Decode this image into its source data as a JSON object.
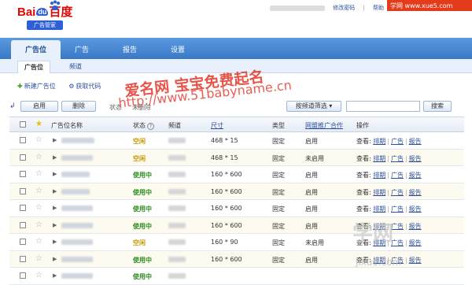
{
  "header": {
    "logo_bai": "Bai",
    "logo_du": "du",
    "logo_cn": "百度",
    "logo_sub": "广告管家",
    "links": [
      "修改密码",
      "帮助"
    ],
    "badge": "学网 www.xue5.com"
  },
  "nav": {
    "tabs": [
      "广告位",
      "广告",
      "报告",
      "设置"
    ],
    "active": "广告位"
  },
  "subnav": {
    "items": [
      "广告位",
      "频道"
    ]
  },
  "actions": {
    "new_label": "新建广告位",
    "code_label": "获取代码"
  },
  "watermark": {
    "line1": "爱名网 宝宝免费起名",
    "line2": "http://www.51babyname.cn",
    "line3": "学网",
    "line4": "jixue.com"
  },
  "toolbar": {
    "enable": "启用",
    "delete": "删除",
    "status_prefix": "状态",
    "status_value": "未删除",
    "filter": "按频道筛选",
    "search": "搜索"
  },
  "table": {
    "headers": {
      "name": "广告位名称",
      "status": "状态",
      "channel": "频道",
      "size": "尺寸",
      "type": "类型",
      "union": "网盟推广合作",
      "ops": "操作"
    },
    "rows": [
      {
        "status": "空闲",
        "size": "468 * 15",
        "type": "固定",
        "union": "启用",
        "view": "查看:"
      },
      {
        "status": "空闲",
        "size": "468 * 15",
        "type": "固定",
        "union": "未启用",
        "view": "查看:"
      },
      {
        "status": "使用中",
        "size": "160 * 600",
        "type": "固定",
        "union": "启用",
        "view": "查看:"
      },
      {
        "status": "使用中",
        "size": "160 * 600",
        "type": "固定",
        "union": "启用",
        "view": "查看:"
      },
      {
        "status": "使用中",
        "size": "160 * 600",
        "type": "固定",
        "union": "启用",
        "view": "查看:"
      },
      {
        "status": "使用中",
        "size": "160 * 600",
        "type": "固定",
        "union": "启用",
        "view": "查看:"
      },
      {
        "status": "空闲",
        "size": "160 * 90",
        "type": "固定",
        "union": "未启用",
        "view": "查看:"
      },
      {
        "status": "使用中",
        "size": "160 * 600",
        "type": "固定",
        "union": "启用",
        "view": "查看:"
      },
      {
        "status": "使用中",
        "size": "",
        "type": "",
        "union": "",
        "view": ""
      }
    ],
    "op_links": [
      "排期",
      "广告",
      "报告"
    ]
  },
  "colors": {
    "nav_bg": "#3a78c7",
    "status_free": "#c79800",
    "status_used": "#2a8a1a",
    "link": "#2c4f9e",
    "watermark": "#e3372a"
  }
}
